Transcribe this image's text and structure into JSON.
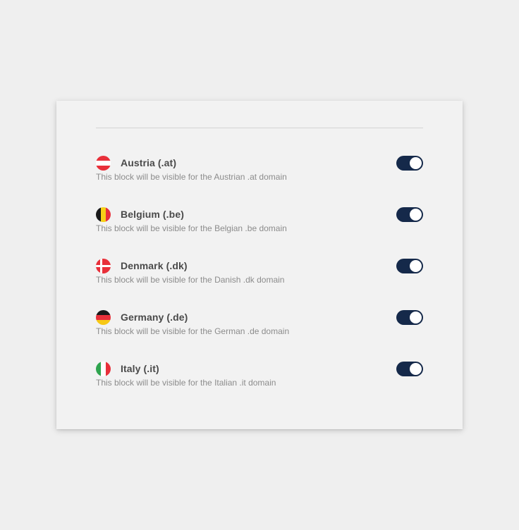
{
  "colors": {
    "toggle_on": "#15294a",
    "title_text": "#4a4a4a",
    "description_text": "#8c8c8c",
    "card_background": "#f2f2f2",
    "page_background": "#efefef"
  },
  "domains": [
    {
      "name": "Austria (.at)",
      "description": "This block will be visible for the Austrian .at domain",
      "flag_icon": "austria-flag-icon",
      "enabled": true
    },
    {
      "name": "Belgium (.be)",
      "description": "This block will be visible for the Belgian .be domain",
      "flag_icon": "belgium-flag-icon",
      "enabled": true
    },
    {
      "name": "Denmark (.dk)",
      "description": "This block will be visible for the Danish .dk domain",
      "flag_icon": "denmark-flag-icon",
      "enabled": true
    },
    {
      "name": "Germany (.de)",
      "description": "This block will be visible for the German .de domain",
      "flag_icon": "germany-flag-icon",
      "enabled": true
    },
    {
      "name": "Italy (.it)",
      "description": "This block will be visible for the Italian .it domain",
      "flag_icon": "italy-flag-icon",
      "enabled": true
    }
  ]
}
